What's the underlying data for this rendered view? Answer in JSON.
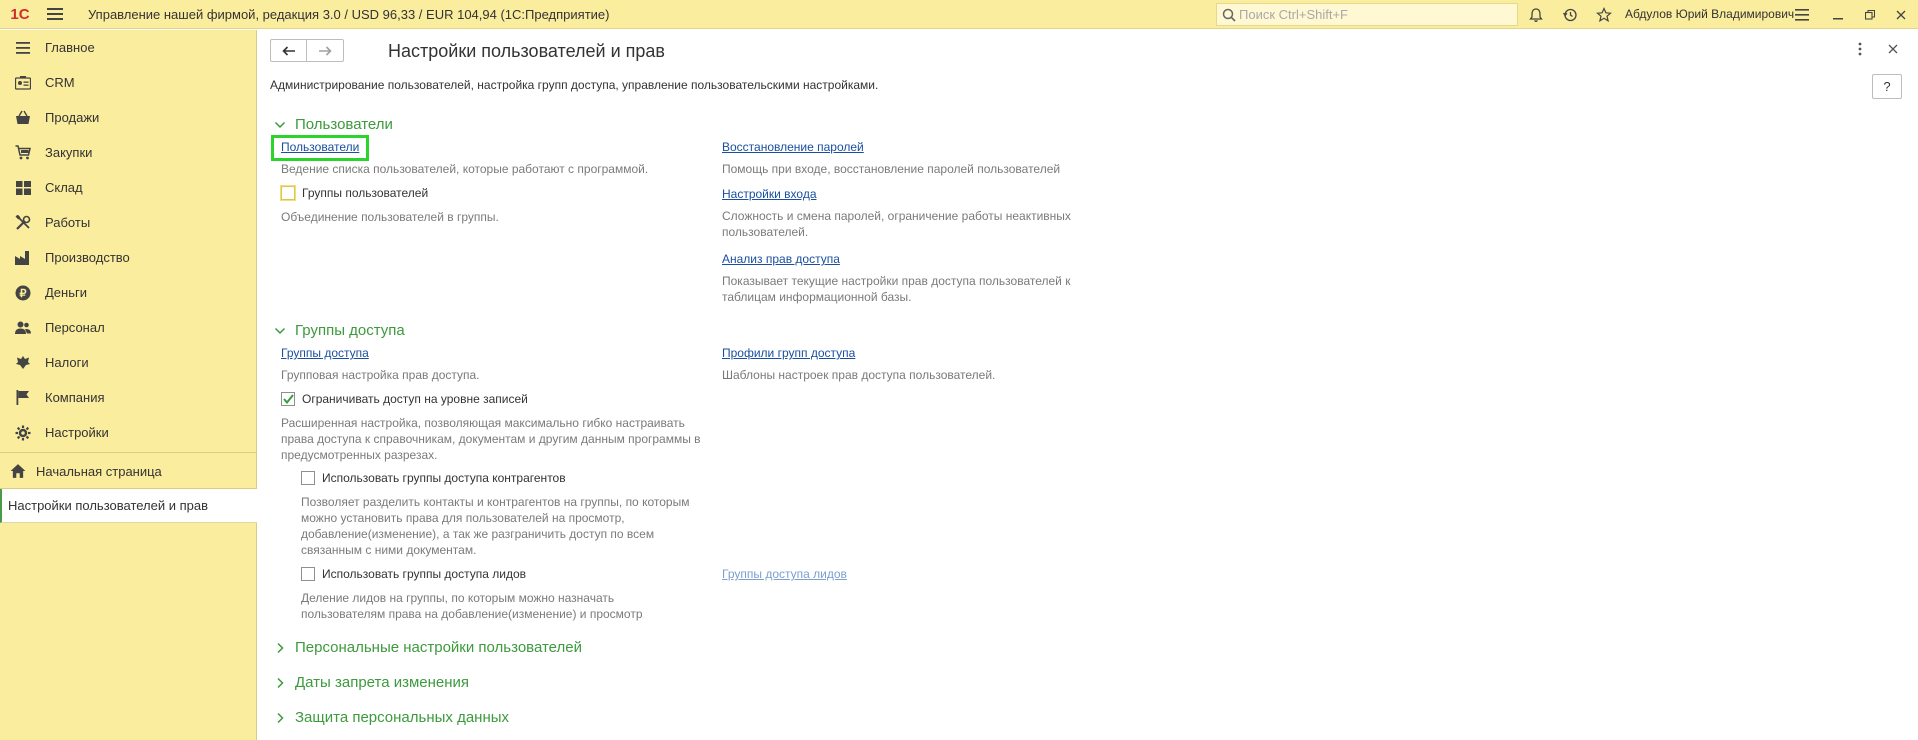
{
  "app": {
    "logo": "1С",
    "title": "Управление нашей фирмой, редакция 3.0 / USD 96,33 / EUR 104,94  (1С:Предприятие)",
    "search_placeholder": "Поиск Ctrl+Shift+F",
    "user": "Абдулов Юрий Владимирович"
  },
  "sidebar": {
    "items": [
      {
        "label": "Главное",
        "icon": "menu-lines-icon"
      },
      {
        "label": "CRM",
        "icon": "crm-card-icon"
      },
      {
        "label": "Продажи",
        "icon": "basket-icon"
      },
      {
        "label": "Закупки",
        "icon": "cart-icon"
      },
      {
        "label": "Склад",
        "icon": "warehouse-icon"
      },
      {
        "label": "Работы",
        "icon": "tools-icon"
      },
      {
        "label": "Производство",
        "icon": "factory-icon"
      },
      {
        "label": "Деньги",
        "icon": "money-icon"
      },
      {
        "label": "Персонал",
        "icon": "people-icon"
      },
      {
        "label": "Налоги",
        "icon": "emblem-icon"
      },
      {
        "label": "Компания",
        "icon": "flag-icon"
      },
      {
        "label": "Настройки",
        "icon": "gear-icon"
      }
    ],
    "home": "Начальная страница",
    "open_window": "Настройки пользователей и прав"
  },
  "page": {
    "title": "Настройки пользователей и прав",
    "description": "Администрирование пользователей, настройка групп доступа, управление пользовательскими настройками.",
    "help": "?"
  },
  "users": {
    "header": "Пользователи",
    "users_link": "Пользователи",
    "users_hint": "Ведение списка пользователей, которые работают с программой.",
    "groups_check": "Группы пользователей",
    "groups_hint": "Объединение пользователей в группы.",
    "restore_link": "Восстановление паролей",
    "restore_hint": "Помощь при входе, восстановление паролей пользователей",
    "login_link": "Настройки входа",
    "login_hint": "Сложность и смена паролей, ограничение работы неактивных пользователей.",
    "analysis_link": "Анализ прав доступа",
    "analysis_hint": "Показывает текущие настройки прав доступа пользователей к таблицам информационной базы."
  },
  "access": {
    "header": "Группы доступа",
    "groups_link": "Группы доступа",
    "groups_hint": "Групповая настройка прав доступа.",
    "profiles_link": "Профили групп доступа",
    "profiles_hint": "Шаблоны настроек прав доступа пользователей.",
    "restrict_check": "Ограничивать доступ на уровне записей",
    "restrict_hint": "Расширенная настройка, позволяющая максимально гибко настраивать права доступа к справочникам, документам и другим данным программы в предусмотренных разрезах.",
    "contractors_check": "Использовать группы доступа контрагентов",
    "contractors_hint": "Позволяет разделить контакты и контрагентов на группы, по которым можно установить права для пользователей на просмотр, добавление(изменение), а так же разграничить доступ по всем связанным с ними документам.",
    "leads_check": "Использовать группы доступа лидов",
    "leads_hint": "Деление лидов на группы, по которым можно назначать пользователям права на добавление(изменение) и просмотр",
    "leads_link": "Группы доступа лидов"
  },
  "sections": {
    "personal": "Персональные настройки пользователей",
    "dates": "Даты запрета изменения",
    "protection": "Защита персональных данных"
  }
}
